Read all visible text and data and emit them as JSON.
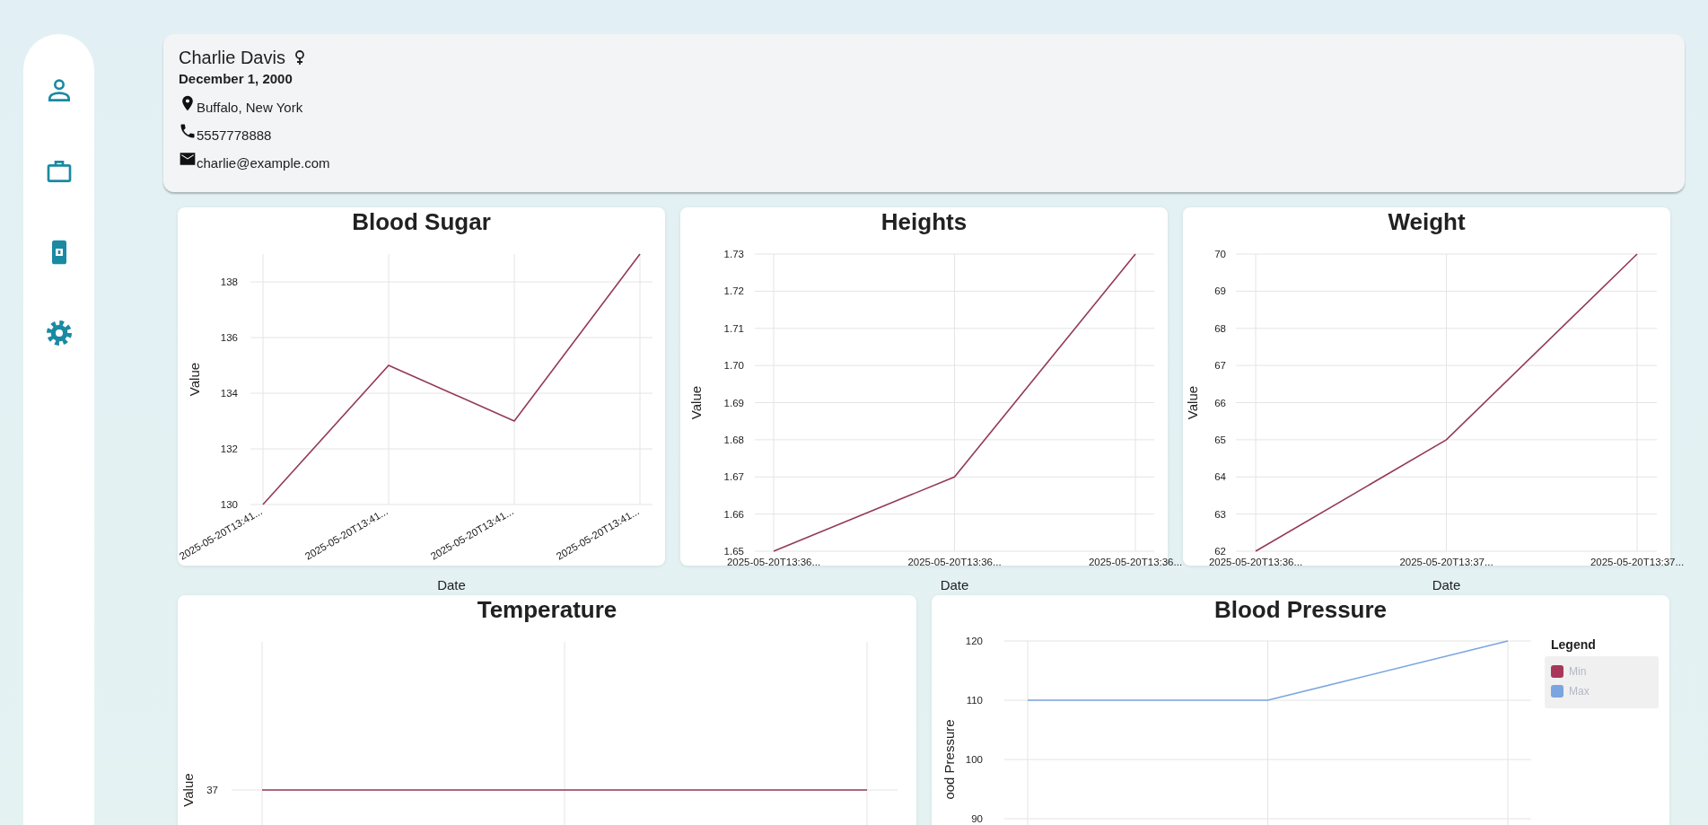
{
  "patient": {
    "name": "Charlie Davis",
    "birth_date": "December 1, 2000",
    "location": "Buffalo, New York",
    "phone": "5557778888",
    "email": "charlie@example.com"
  },
  "charts": [
    {
      "chart_data": {
        "type": "line",
        "title": "Blood Sugar",
        "xlabel": "Date",
        "ylabel": "Value",
        "categories": [
          "2025-05-20T13:41...",
          "2025-05-20T13:41...",
          "2025-05-20T13:41...",
          "2025-05-20T13:41..."
        ],
        "values": [
          130,
          135,
          133,
          139
        ],
        "grid": true,
        "ylim": [
          130,
          139
        ],
        "yticks": [
          130,
          132,
          134,
          136,
          138
        ]
      }
    },
    {
      "chart_data": {
        "type": "line",
        "title": "Heights",
        "xlabel": "Date",
        "ylabel": "Value",
        "categories": [
          "2025-05-20T13:36...",
          "2025-05-20T13:36...",
          "2025-05-20T13:36..."
        ],
        "values": [
          1.65,
          1.67,
          1.73
        ],
        "grid": true,
        "ylim": [
          1.65,
          1.73
        ],
        "yticks": [
          1.65,
          1.66,
          1.67,
          1.68,
          1.69,
          {
            "value": 1.7,
            "label": "1.70"
          },
          1.71,
          1.72,
          1.73
        ]
      }
    },
    {
      "chart_data": {
        "type": "line",
        "title": "Weight",
        "xlabel": "Date",
        "ylabel": "Value",
        "categories": [
          "2025-05-20T13:36...",
          "2025-05-20T13:37...",
          "2025-05-20T13:37..."
        ],
        "values": [
          62,
          65,
          70
        ],
        "grid": true,
        "ylim": [
          62,
          70
        ],
        "yticks": [
          62,
          63,
          64,
          65,
          66,
          67,
          68,
          69,
          70
        ]
      }
    },
    {
      "title": "Temperature",
      "ylabel": "Value",
      "line_label": "37"
    },
    {
      "chart_data": {
        "type": "line",
        "title": "Blood Pressure",
        "ylabel": "ood Pressure",
        "legend_title": "Legend",
        "series": [
          {
            "name": "Min",
            "color": "#a8385a",
            "values": [
              null,
              null,
              null
            ]
          },
          {
            "name": "Max",
            "color": "#7ba4e0",
            "values": [
              110,
              110,
              120
            ]
          }
        ],
        "grid": true,
        "ylim": [
          80,
          120
        ],
        "yticks": [
          90,
          100,
          110,
          120
        ]
      }
    }
  ]
}
